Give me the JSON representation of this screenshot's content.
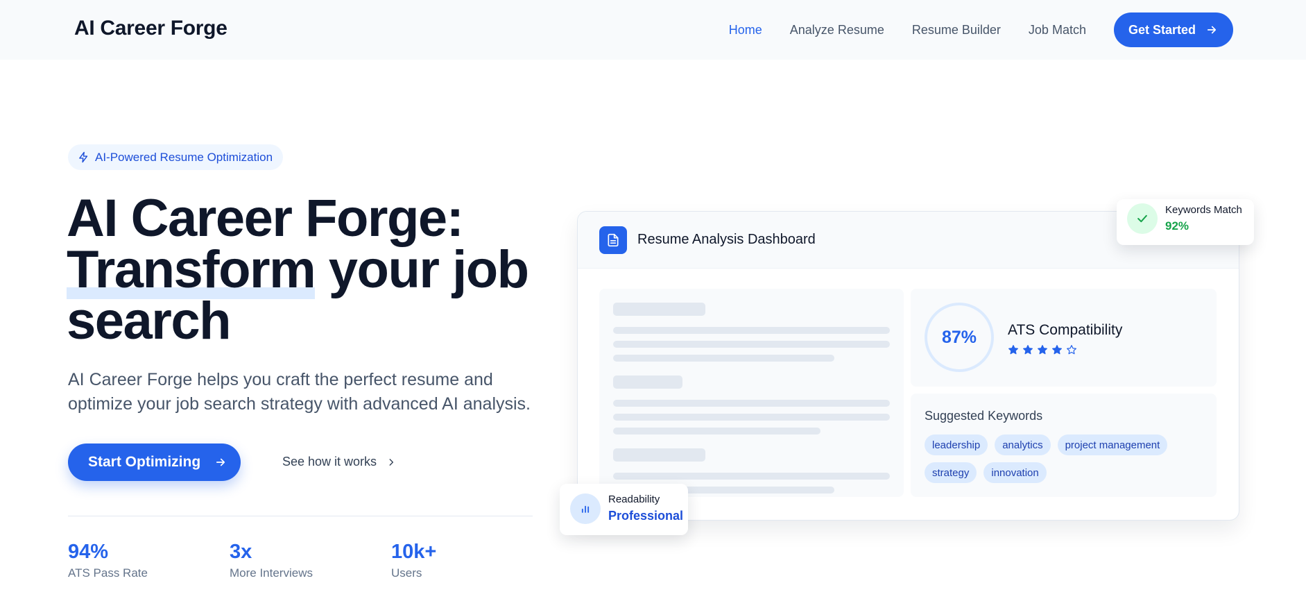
{
  "header": {
    "logo": "AI Career Forge",
    "nav": [
      {
        "label": "Home",
        "active": true
      },
      {
        "label": "Analyze Resume",
        "active": false
      },
      {
        "label": "Resume Builder",
        "active": false
      },
      {
        "label": "Job Match",
        "active": false
      }
    ],
    "cta_label": "Get Started"
  },
  "hero": {
    "badge": "AI-Powered Resume Optimization",
    "headline_line1": "AI Career Forge:",
    "headline_highlight": "Transform",
    "headline_rest": " your job",
    "headline_line3": "search",
    "description": "AI Career Forge helps you craft the perfect resume and optimize your job search strategy with advanced AI analysis.",
    "primary_cta": "Start Optimizing",
    "secondary_cta": "See how it works",
    "stats": [
      {
        "value": "94%",
        "label": "ATS Pass Rate"
      },
      {
        "value": "3x",
        "label": "More Interviews"
      },
      {
        "value": "10k+",
        "label": "Users"
      }
    ]
  },
  "dashboard": {
    "title": "Resume Analysis Dashboard",
    "ats_score": "87%",
    "ats_title": "ATS Compatibility",
    "ats_rating": 4,
    "ats_rating_max": 5,
    "keywords_title": "Suggested Keywords",
    "keywords": [
      "leadership",
      "analytics",
      "project management",
      "strategy",
      "innovation"
    ]
  },
  "floating": {
    "keywords_match_label": "Keywords Match",
    "keywords_match_value": "92%",
    "readability_label": "Readability",
    "readability_value": "Professional"
  },
  "colors": {
    "accent": "#2563eb",
    "success": "#16a34a",
    "text": "#0f172a",
    "muted": "#64748b"
  },
  "icons": {
    "badge": "lightning-icon",
    "cta": "arrow-right-icon",
    "secondary": "chevron-right-icon",
    "dashboard": "document-icon",
    "keywords_match": "check-icon",
    "readability": "bar-chart-icon",
    "rating": "star-icon"
  }
}
